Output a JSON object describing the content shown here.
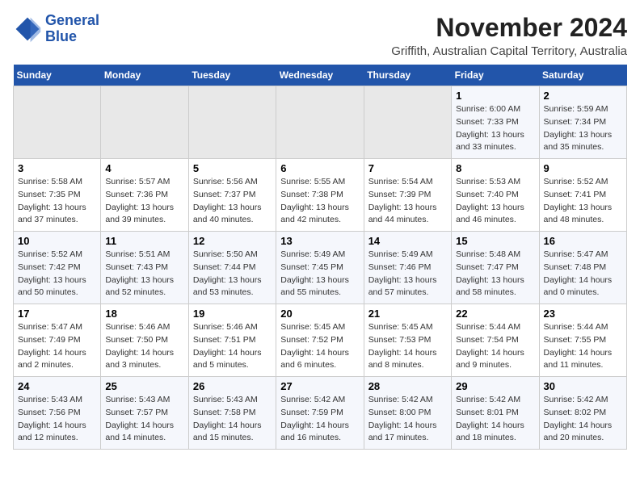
{
  "logo": {
    "line1": "General",
    "line2": "Blue"
  },
  "title": "November 2024",
  "location": "Griffith, Australian Capital Territory, Australia",
  "days_of_week": [
    "Sunday",
    "Monday",
    "Tuesday",
    "Wednesday",
    "Thursday",
    "Friday",
    "Saturday"
  ],
  "weeks": [
    [
      {
        "day": "",
        "info": ""
      },
      {
        "day": "",
        "info": ""
      },
      {
        "day": "",
        "info": ""
      },
      {
        "day": "",
        "info": ""
      },
      {
        "day": "",
        "info": ""
      },
      {
        "day": "1",
        "info": "Sunrise: 6:00 AM\nSunset: 7:33 PM\nDaylight: 13 hours\nand 33 minutes."
      },
      {
        "day": "2",
        "info": "Sunrise: 5:59 AM\nSunset: 7:34 PM\nDaylight: 13 hours\nand 35 minutes."
      }
    ],
    [
      {
        "day": "3",
        "info": "Sunrise: 5:58 AM\nSunset: 7:35 PM\nDaylight: 13 hours\nand 37 minutes."
      },
      {
        "day": "4",
        "info": "Sunrise: 5:57 AM\nSunset: 7:36 PM\nDaylight: 13 hours\nand 39 minutes."
      },
      {
        "day": "5",
        "info": "Sunrise: 5:56 AM\nSunset: 7:37 PM\nDaylight: 13 hours\nand 40 minutes."
      },
      {
        "day": "6",
        "info": "Sunrise: 5:55 AM\nSunset: 7:38 PM\nDaylight: 13 hours\nand 42 minutes."
      },
      {
        "day": "7",
        "info": "Sunrise: 5:54 AM\nSunset: 7:39 PM\nDaylight: 13 hours\nand 44 minutes."
      },
      {
        "day": "8",
        "info": "Sunrise: 5:53 AM\nSunset: 7:40 PM\nDaylight: 13 hours\nand 46 minutes."
      },
      {
        "day": "9",
        "info": "Sunrise: 5:52 AM\nSunset: 7:41 PM\nDaylight: 13 hours\nand 48 minutes."
      }
    ],
    [
      {
        "day": "10",
        "info": "Sunrise: 5:52 AM\nSunset: 7:42 PM\nDaylight: 13 hours\nand 50 minutes."
      },
      {
        "day": "11",
        "info": "Sunrise: 5:51 AM\nSunset: 7:43 PM\nDaylight: 13 hours\nand 52 minutes."
      },
      {
        "day": "12",
        "info": "Sunrise: 5:50 AM\nSunset: 7:44 PM\nDaylight: 13 hours\nand 53 minutes."
      },
      {
        "day": "13",
        "info": "Sunrise: 5:49 AM\nSunset: 7:45 PM\nDaylight: 13 hours\nand 55 minutes."
      },
      {
        "day": "14",
        "info": "Sunrise: 5:49 AM\nSunset: 7:46 PM\nDaylight: 13 hours\nand 57 minutes."
      },
      {
        "day": "15",
        "info": "Sunrise: 5:48 AM\nSunset: 7:47 PM\nDaylight: 13 hours\nand 58 minutes."
      },
      {
        "day": "16",
        "info": "Sunrise: 5:47 AM\nSunset: 7:48 PM\nDaylight: 14 hours\nand 0 minutes."
      }
    ],
    [
      {
        "day": "17",
        "info": "Sunrise: 5:47 AM\nSunset: 7:49 PM\nDaylight: 14 hours\nand 2 minutes."
      },
      {
        "day": "18",
        "info": "Sunrise: 5:46 AM\nSunset: 7:50 PM\nDaylight: 14 hours\nand 3 minutes."
      },
      {
        "day": "19",
        "info": "Sunrise: 5:46 AM\nSunset: 7:51 PM\nDaylight: 14 hours\nand 5 minutes."
      },
      {
        "day": "20",
        "info": "Sunrise: 5:45 AM\nSunset: 7:52 PM\nDaylight: 14 hours\nand 6 minutes."
      },
      {
        "day": "21",
        "info": "Sunrise: 5:45 AM\nSunset: 7:53 PM\nDaylight: 14 hours\nand 8 minutes."
      },
      {
        "day": "22",
        "info": "Sunrise: 5:44 AM\nSunset: 7:54 PM\nDaylight: 14 hours\nand 9 minutes."
      },
      {
        "day": "23",
        "info": "Sunrise: 5:44 AM\nSunset: 7:55 PM\nDaylight: 14 hours\nand 11 minutes."
      }
    ],
    [
      {
        "day": "24",
        "info": "Sunrise: 5:43 AM\nSunset: 7:56 PM\nDaylight: 14 hours\nand 12 minutes."
      },
      {
        "day": "25",
        "info": "Sunrise: 5:43 AM\nSunset: 7:57 PM\nDaylight: 14 hours\nand 14 minutes."
      },
      {
        "day": "26",
        "info": "Sunrise: 5:43 AM\nSunset: 7:58 PM\nDaylight: 14 hours\nand 15 minutes."
      },
      {
        "day": "27",
        "info": "Sunrise: 5:42 AM\nSunset: 7:59 PM\nDaylight: 14 hours\nand 16 minutes."
      },
      {
        "day": "28",
        "info": "Sunrise: 5:42 AM\nSunset: 8:00 PM\nDaylight: 14 hours\nand 17 minutes."
      },
      {
        "day": "29",
        "info": "Sunrise: 5:42 AM\nSunset: 8:01 PM\nDaylight: 14 hours\nand 18 minutes."
      },
      {
        "day": "30",
        "info": "Sunrise: 5:42 AM\nSunset: 8:02 PM\nDaylight: 14 hours\nand 20 minutes."
      }
    ]
  ]
}
